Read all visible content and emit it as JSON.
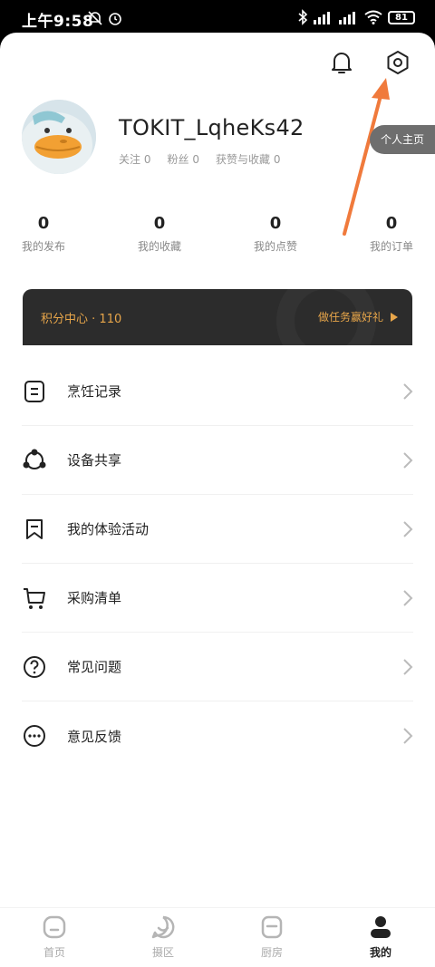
{
  "status_bar": {
    "time": "上午9:58",
    "battery": "81"
  },
  "profile": {
    "username": "TOKIT_LqheKs42",
    "stats": [
      {
        "label": "关注",
        "value": "0"
      },
      {
        "label": "粉丝",
        "value": "0"
      },
      {
        "label": "获赞与收藏",
        "value": "0"
      }
    ],
    "homepage_button": "个人主页"
  },
  "counts": [
    {
      "value": "0",
      "label": "我的发布"
    },
    {
      "value": "0",
      "label": "我的收藏"
    },
    {
      "value": "0",
      "label": "我的点赞"
    },
    {
      "value": "0",
      "label": "我的订单"
    }
  ],
  "points": {
    "label": "积分中心",
    "value": "110",
    "task_text": "做任务赢好礼"
  },
  "menu": [
    {
      "label": "烹饪记录",
      "icon": "cooking-record-icon"
    },
    {
      "label": "设备共享",
      "icon": "device-share-icon"
    },
    {
      "label": "我的体验活动",
      "icon": "bookmark-icon"
    },
    {
      "label": "采购清单",
      "icon": "cart-icon"
    },
    {
      "label": "常见问题",
      "icon": "question-icon"
    },
    {
      "label": "意见反馈",
      "icon": "feedback-icon"
    }
  ],
  "tabs": [
    {
      "label": "首页",
      "icon": "home-icon"
    },
    {
      "label": "摄区",
      "icon": "community-icon"
    },
    {
      "label": "厨房",
      "icon": "kitchen-icon"
    },
    {
      "label": "我的",
      "icon": "profile-icon",
      "active": true
    }
  ],
  "colors": {
    "accent_orange": "#e8a64a",
    "annotation_arrow": "#f07a3c",
    "points_bar_bg": "#2c2c2c"
  }
}
